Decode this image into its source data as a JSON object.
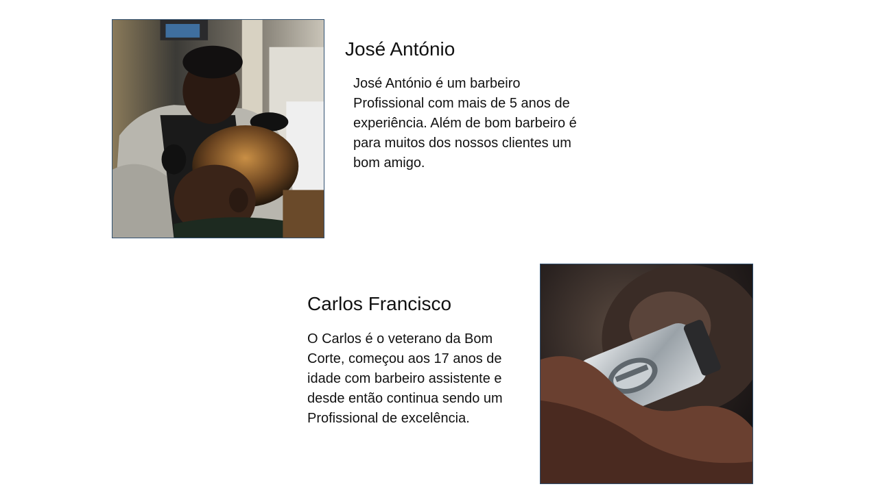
{
  "barbers": [
    {
      "name": "José António",
      "bio": "José António é um barbeiro Profissional com mais de 5 anos de experiência. Além de bom barbeiro é para muitos dos nossos clientes um bom amigo.",
      "photo_icon": "barber-cutting-hair-photo"
    },
    {
      "name": "Carlos Francisco",
      "bio": "O Carlos é o veterano da Bom Corte, começou aos 17 anos de idade com barbeiro assistente e desde então continua sendo um Profissional de excelência.",
      "photo_icon": "hair-clipper-photo"
    }
  ],
  "colors": {
    "background": "#ffffff",
    "text": "#111111",
    "photo_border": "#2f4f6f"
  }
}
